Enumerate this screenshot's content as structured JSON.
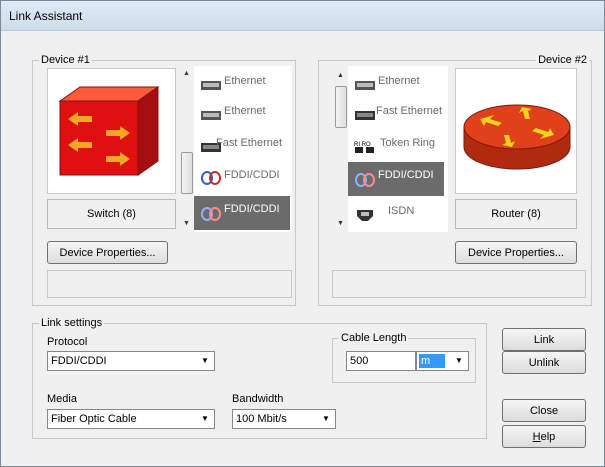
{
  "window": {
    "title": "Link Assistant"
  },
  "device1": {
    "legend": "Device #1",
    "name": "Switch (8)",
    "properties_button": "Device Properties...",
    "ports": [
      {
        "label": "Ethernet",
        "icon": "ethernet-port-icon",
        "selected": false
      },
      {
        "label": "Ethernet",
        "icon": "ethernet-port-icon",
        "selected": false
      },
      {
        "label": "Fast Ethernet",
        "icon": "fast-ethernet-port-icon",
        "selected": false
      },
      {
        "label": "FDDI/CDDI",
        "icon": "fddi-port-icon",
        "selected": false
      },
      {
        "label": "FDDI/CDDI",
        "icon": "fddi-port-icon",
        "selected": true
      }
    ]
  },
  "device2": {
    "legend": "Device #2",
    "name": "Router (8)",
    "properties_button": "Device Properties...",
    "ports": [
      {
        "label": "Ethernet",
        "icon": "ethernet-port-icon",
        "selected": false
      },
      {
        "label": "Fast Ethernet",
        "icon": "fast-ethernet-port-icon",
        "selected": false
      },
      {
        "label": "Token Ring",
        "icon": "token-ring-port-icon",
        "selected": false
      },
      {
        "label": "FDDI/CDDI",
        "icon": "fddi-port-icon",
        "selected": true
      },
      {
        "label": "ISDN",
        "icon": "isdn-port-icon",
        "selected": false
      }
    ]
  },
  "link_settings": {
    "legend": "Link settings",
    "protocol_label": "Protocol",
    "protocol_value": "FDDI/CDDI",
    "media_label": "Media",
    "media_value": "Fiber Optic Cable",
    "bandwidth_label": "Bandwidth",
    "bandwidth_value": "100 Mbit/s",
    "cable_legend": "Cable Length",
    "cable_value": "500",
    "cable_unit": "m"
  },
  "buttons": {
    "link": "Link",
    "unlink": "Unlink",
    "close": "Close",
    "help_prefix": "H",
    "help_rest": "elp"
  },
  "colors": {
    "switch_red": "#e01010",
    "router_red": "#d23a16",
    "arrow_orange": "#f5a623",
    "selected_row": "#6b6b6b",
    "unit_highlight": "#3399ff"
  }
}
